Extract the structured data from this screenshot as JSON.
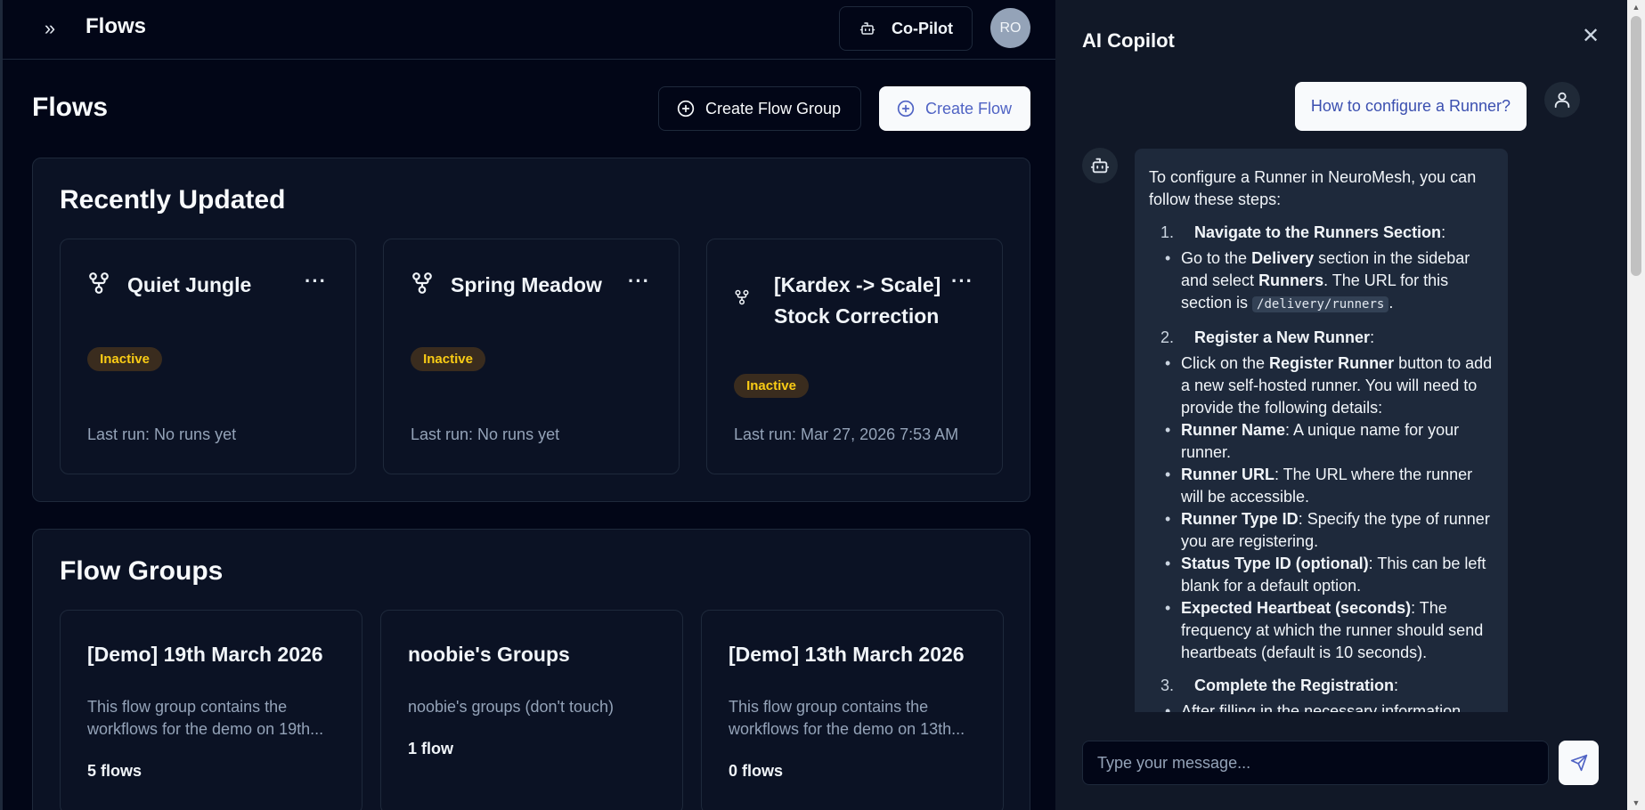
{
  "header": {
    "title": "Flows",
    "copilot_label": "Co-Pilot",
    "avatar_initials": "RO"
  },
  "page": {
    "heading": "Flows",
    "create_group_label": "Create Flow Group",
    "create_flow_label": "Create Flow"
  },
  "recent": {
    "title": "Recently Updated",
    "cards": [
      {
        "name": "Quiet Jungle",
        "status": "Inactive",
        "last_run": "Last run: No runs yet"
      },
      {
        "name": "Spring Meadow",
        "status": "Inactive",
        "last_run": "Last run: No runs yet"
      },
      {
        "name": "[Kardex -> Scale] Stock Correction",
        "status": "Inactive",
        "last_run": "Last run: Mar 27, 2026 7:53 AM"
      }
    ]
  },
  "groups": {
    "title": "Flow Groups",
    "cards": [
      {
        "name": "[Demo] 19th March 2026",
        "description": "This flow group contains the workflows for the demo on 19th...",
        "count": "5 flows"
      },
      {
        "name": "noobie's Groups",
        "description": "noobie's groups (don't touch)",
        "count": "1 flow"
      },
      {
        "name": "[Demo] 13th March 2026",
        "description": "This flow group contains the workflows for the demo on 13th...",
        "count": "0 flows"
      }
    ]
  },
  "copilot": {
    "title": "AI Copilot",
    "user_message": "How to configure a Runner?",
    "bot": {
      "intro": "To configure a Runner in NeuroMesh, you can follow these steps:",
      "step1": {
        "num": "1.",
        "title": "Navigate to the Runners Section",
        "b1_a": "Go to the ",
        "b1_b": "Delivery",
        "b1_c": " section in the sidebar and select ",
        "b1_d": "Runners",
        "b1_e": ". The URL for this section is ",
        "b1_code": "/delivery/runners",
        "b1_f": "."
      },
      "step2": {
        "num": "2.",
        "title": "Register a New Runner",
        "b1_a": "Click on the ",
        "b1_b": "Register Runner",
        "b1_c": " button to add a new self-hosted runner. You will need to provide the following details:",
        "b2_k": "Runner Name",
        "b2_v": ": A unique name for your runner.",
        "b3_k": "Runner URL",
        "b3_v": ": The URL where the runner will be accessible.",
        "b4_k": "Runner Type ID",
        "b4_v": ": Specify the type of runner you are registering.",
        "b5_k": "Status Type ID (optional)",
        "b5_v": ": This can be left blank for a default option.",
        "b6_k": "Expected Heartbeat (seconds)",
        "b6_v": ": The frequency at which the runner should send heartbeats (default is 10 seconds)."
      },
      "step3": {
        "num": "3.",
        "title": "Complete the Registration",
        "b1": "After filling in the necessary information,"
      }
    },
    "input_placeholder": "Type your message..."
  },
  "icons": {
    "expand": "chevrons-right-icon",
    "copilot": "bot-icon",
    "plus": "plus-circle-icon",
    "flow": "workflow-icon",
    "menu": "more-horizontal-icon",
    "close": "close-icon",
    "user": "user-icon",
    "send": "send-icon"
  },
  "colors": {
    "background": "#020617",
    "panel": "#0b1224",
    "copilot_bg": "#111827",
    "badge_bg": "#3a2c1e",
    "badge_text": "#facc15",
    "accent_text": "#4f63c4"
  }
}
